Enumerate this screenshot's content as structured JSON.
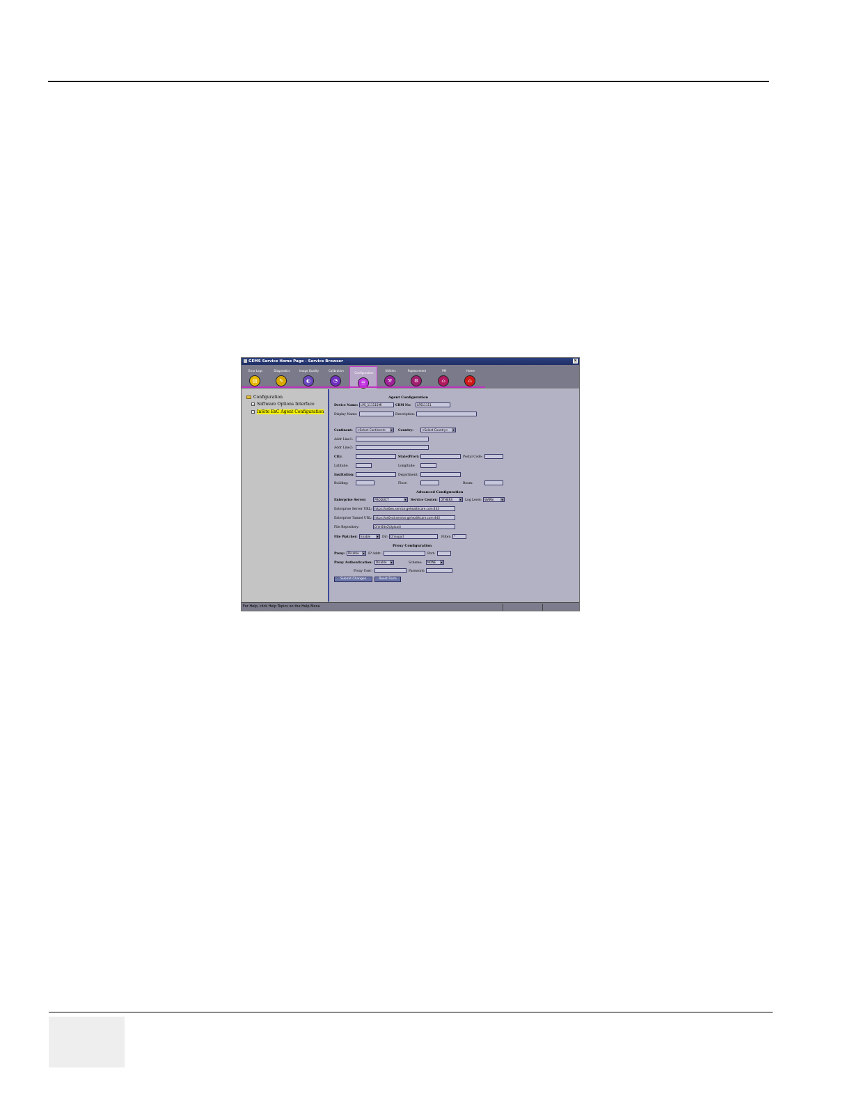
{
  "window": {
    "title": "GEMS Service Home Page - Service Browser",
    "close_glyph": "×",
    "status_text": "For Help, click Help Topics on the Help Menu"
  },
  "toolbar": [
    {
      "label": "Error Logs",
      "color": "#e8b800",
      "icon": "error-logs-icon"
    },
    {
      "label": "Diagnostics",
      "color": "#d8a800",
      "icon": "diagnostics-icon"
    },
    {
      "label": "Image Quality",
      "color": "#6a48c0",
      "icon": "image-quality-icon"
    },
    {
      "label": "Calibration",
      "color": "#7030c0",
      "icon": "calibration-icon"
    },
    {
      "label": "Configuration",
      "color": "#c030e0",
      "icon": "configuration-icon",
      "active": true
    },
    {
      "label": "Utilities",
      "color": "#a02098",
      "icon": "utilities-icon"
    },
    {
      "label": "Replacement",
      "color": "#a02070",
      "icon": "replacement-icon"
    },
    {
      "label": "PM",
      "color": "#b01860",
      "icon": "pm-icon"
    },
    {
      "label": "Home",
      "color": "#d01818",
      "icon": "home-icon"
    }
  ],
  "tree": {
    "root": "Configuration",
    "items": [
      "Software Options Interface",
      "InSite ExC Agent Configuration"
    ]
  },
  "form": {
    "agent_title": "Agent Configuration",
    "device_name_label": "Device Name:",
    "device_name_value": "LPS_111115MI",
    "crm_label": "CRM No:",
    "crm_value": "LPS11111",
    "display_name_label": "Display Name:",
    "description_label": "Description:",
    "continent_label": "Continent:",
    "continent_value": "<Select Continent>",
    "country_label": "Country:",
    "country_value": "<Select Country>",
    "addr1_label": "Addr Line1:",
    "addr2_label": "Addr Line2:",
    "city_label": "City:",
    "state_label": "State(Prov):",
    "postal_label": "Postal Code:",
    "latitude_label": "Latitude:",
    "longitude_label": "Longitude:",
    "institution_label": "Institution:",
    "department_label": "Department:",
    "building_label": "Building:",
    "floor_label": "Floor:",
    "room_label": "Room:",
    "advanced_title": "Advanced Configuration",
    "enterprise_server_label": "Enterprise Server:",
    "enterprise_server_value": "PRODUCT",
    "service_center_label": "Service Center:",
    "service_center_value": "OTHERS",
    "log_level_label": "Log Level:",
    "log_level_value": "WARN",
    "es_url_label": "Enterprise Server URL:",
    "es_url_value": "https://us0ws.service.gehealthcare.com:443",
    "et_url_label": "Enterprise Tunnel URL:",
    "et_url_value": "https://us0rsd.service.gehealthcare.com:443",
    "file_repo_label": "File Repository:",
    "file_repo_value": "D:\\InSite2\\Upload\\",
    "file_watcher_label": "File Watcher:",
    "file_watcher_value": "Enable",
    "dir_label": "Dir:",
    "dir_value": "D:\\export",
    "filter_label": "Filter:",
    "filter_value": "*",
    "proxy_title": "Proxy Configuration",
    "proxy_label": "Proxy:",
    "proxy_value": "Disable",
    "ip_label": "IP Addr:",
    "port_label": "Port:",
    "proxy_auth_label": "Proxy Authentication:",
    "proxy_auth_value": "Disable",
    "scheme_label": "Scheme:",
    "scheme_value": "NONE",
    "proxy_user_label": "Proxy User:",
    "password_label": "Password:",
    "submit_label": "Submit Changes",
    "reset_label": "Reset Form"
  }
}
